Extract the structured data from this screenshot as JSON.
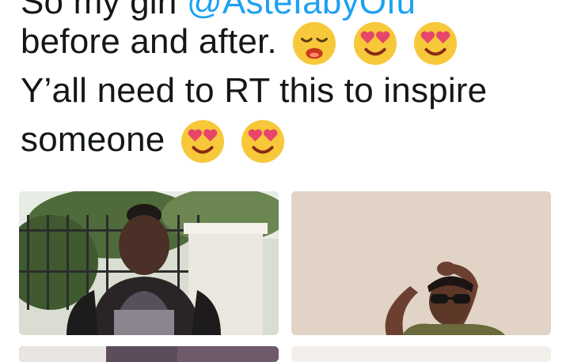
{
  "tweet": {
    "line1": {
      "prefix": "So my girl",
      "mention": "@AsteIabyOfu"
    },
    "line2": "before and after.",
    "line3": "Y’all need to RT this to inspire",
    "line4": "someone"
  },
  "emojis": {
    "line2": [
      "weary-face-icon",
      "heart-eyes-icon",
      "heart-eyes-icon"
    ],
    "line4": [
      "heart-eyes-icon",
      "heart-eyes-icon"
    ]
  },
  "colors": {
    "text": "#14171a",
    "mention": "#1da1f2",
    "emoji_face": "#f7c83a",
    "emoji_heart": "#e8456b"
  }
}
